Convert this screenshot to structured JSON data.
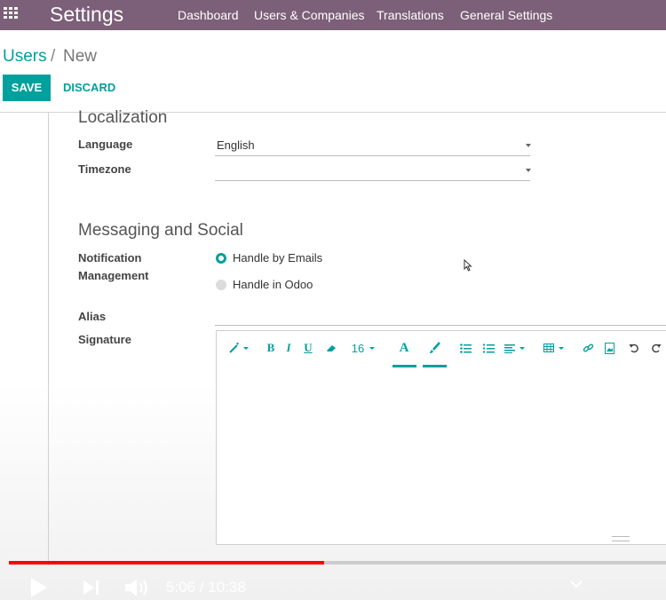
{
  "navbar": {
    "title": "Settings",
    "menu": [
      "Dashboard",
      "Users & Companies",
      "Translations",
      "General Settings"
    ]
  },
  "breadcrumb": {
    "parent": "Users",
    "separator": "/",
    "current": "New"
  },
  "buttons": {
    "save": "SAVE",
    "discard": "DISCARD"
  },
  "localization": {
    "title": "Localization",
    "language_label": "Language",
    "language_value": "English",
    "timezone_label": "Timezone",
    "timezone_value": ""
  },
  "messaging": {
    "title": "Messaging and Social",
    "notification_label_1": "Notification",
    "notification_label_2": "Management",
    "options": [
      "Handle by Emails",
      "Handle in Odoo"
    ],
    "selected": "Handle by Emails",
    "alias_label": "Alias",
    "signature_label": "Signature"
  },
  "editor_toolbar": {
    "font_size": "16",
    "tools": [
      "style",
      "bold",
      "italic",
      "underline",
      "eraser",
      "font-size",
      "font-color",
      "highlight",
      "bullet-list",
      "numbered-list",
      "align",
      "table",
      "link",
      "image",
      "undo",
      "redo"
    ]
  },
  "video": {
    "time": "5:06 / 10:38",
    "progress": 0.48
  },
  "colors": {
    "navbar": "#7c5f78",
    "accent": "#00a09d",
    "progress": "#ff0000"
  }
}
